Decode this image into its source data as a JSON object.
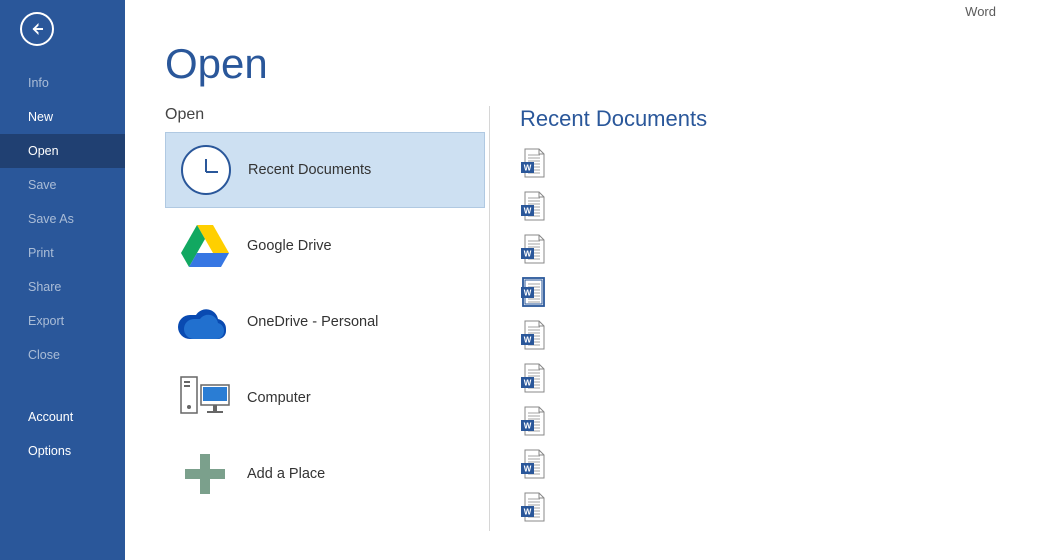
{
  "app_title": "Word",
  "page_title": "Open",
  "sidebar": {
    "items": [
      {
        "label": "Info",
        "state": "dim"
      },
      {
        "label": "New",
        "state": "bright"
      },
      {
        "label": "Open",
        "state": "active"
      },
      {
        "label": "Save",
        "state": "dim"
      },
      {
        "label": "Save As",
        "state": "dim"
      },
      {
        "label": "Print",
        "state": "dim"
      },
      {
        "label": "Share",
        "state": "dim"
      },
      {
        "label": "Export",
        "state": "dim"
      },
      {
        "label": "Close",
        "state": "dim"
      }
    ],
    "footer": [
      {
        "label": "Account"
      },
      {
        "label": "Options"
      }
    ]
  },
  "sources": {
    "heading": "Open",
    "items": [
      {
        "icon": "clock",
        "label": "Recent Documents",
        "selected": true
      },
      {
        "icon": "gdrive",
        "label": "Google Drive",
        "selected": false
      },
      {
        "icon": "onedrive",
        "label": "OneDrive - Personal",
        "selected": false
      },
      {
        "icon": "computer",
        "label": "Computer",
        "selected": false
      },
      {
        "icon": "plus",
        "label": "Add a Place",
        "selected": false
      }
    ]
  },
  "recent": {
    "heading": "Recent Documents",
    "docs": [
      {
        "type": "docx"
      },
      {
        "type": "docx"
      },
      {
        "type": "docx"
      },
      {
        "type": "doc"
      },
      {
        "type": "docx"
      },
      {
        "type": "docx"
      },
      {
        "type": "docx"
      },
      {
        "type": "docx"
      },
      {
        "type": "docx"
      }
    ]
  }
}
